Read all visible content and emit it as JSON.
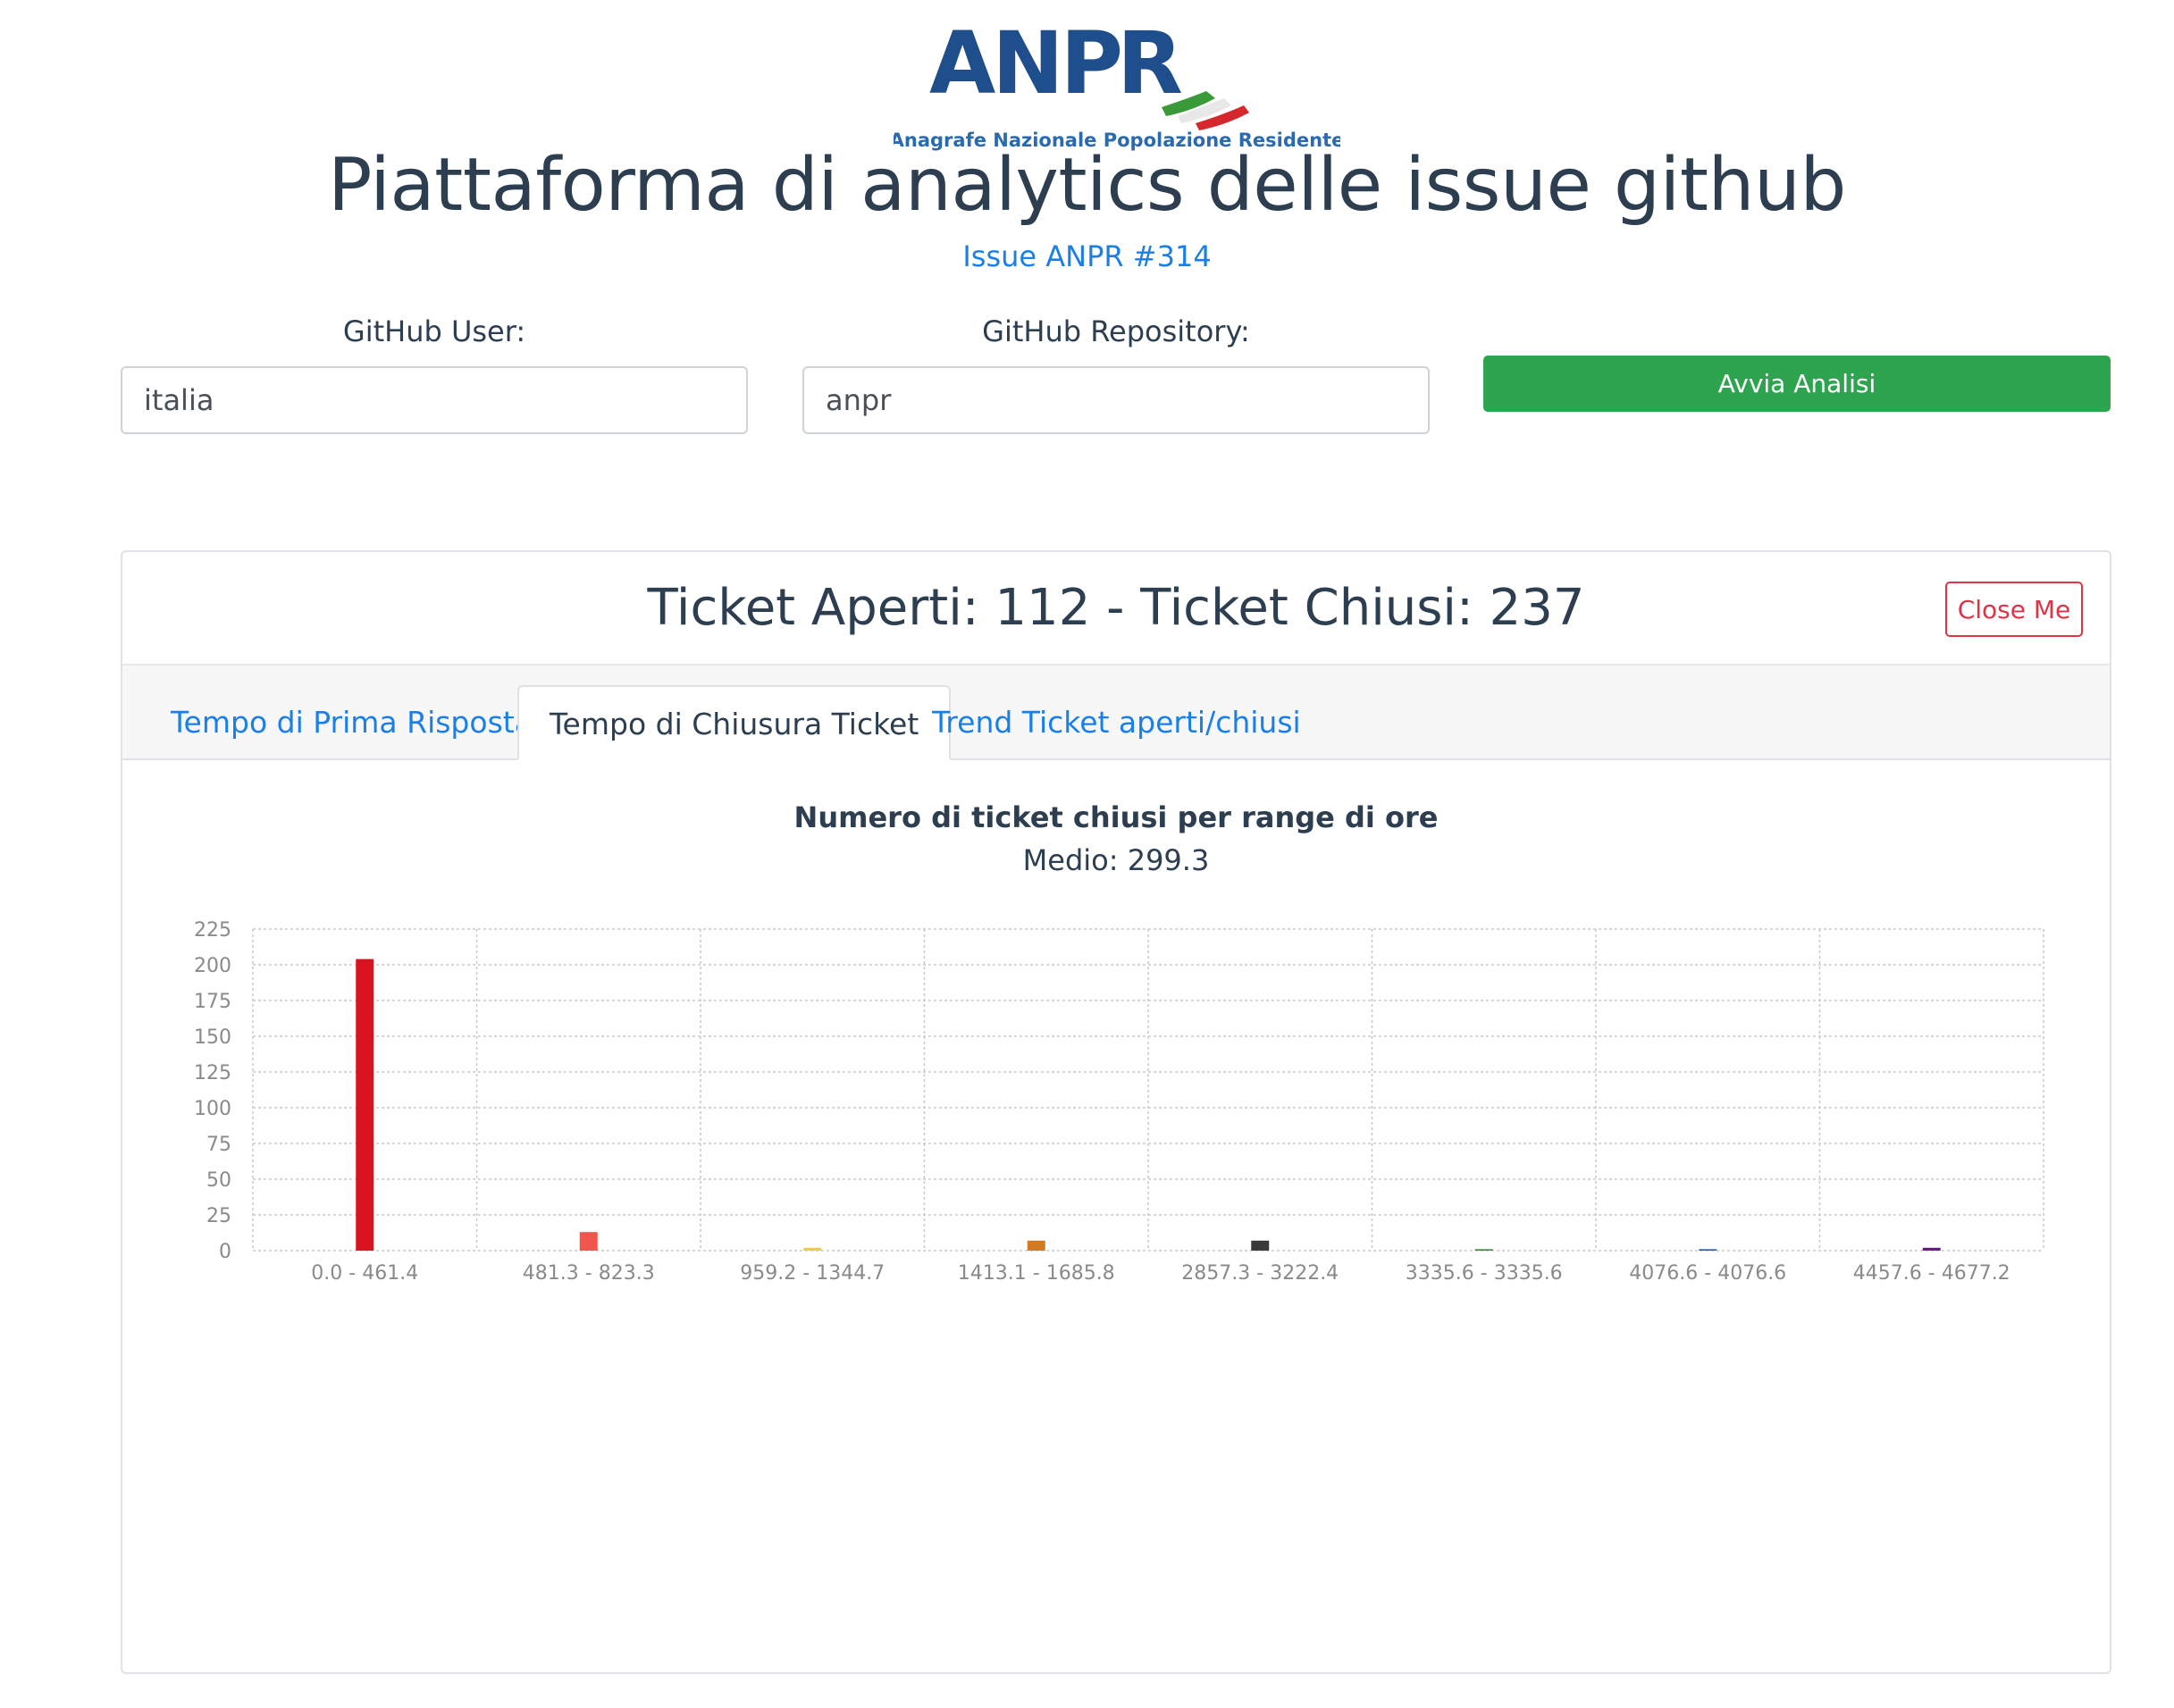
{
  "logo": {
    "brand": "ANPR",
    "tagline": "Anagrafe Nazionale Popolazione Residente",
    "colors": {
      "brand_blue": "#1f4e8c",
      "flag_green": "#3a9a3a",
      "flag_red": "#d6262e"
    }
  },
  "header": {
    "title": "Piattaforma di analytics delle issue github",
    "issue_link": "Issue ANPR #314"
  },
  "form": {
    "user_label": "GitHub User:",
    "user_value": "italia",
    "repo_label": "GitHub Repository:",
    "repo_value": "anpr",
    "start_button": "Avvia Analisi"
  },
  "results": {
    "title": "Ticket Aperti: 112 - Ticket Chiusi: 237",
    "close_button": "Close Me",
    "tabs": [
      {
        "label": "Tempo di Prima Risposta",
        "active": false
      },
      {
        "label": "Tempo di Chiusura Ticket",
        "active": true
      },
      {
        "label": "Trend Ticket aperti/chiusi",
        "active": false
      }
    ]
  },
  "chart_data": {
    "type": "bar",
    "title": "Numero di ticket chiusi per range di ore",
    "subtitle": "Medio: 299.3",
    "xlabel": "",
    "ylabel": "",
    "ylim": [
      0,
      225
    ],
    "yticks": [
      0,
      25,
      50,
      75,
      100,
      125,
      150,
      175,
      200,
      225
    ],
    "grid": true,
    "categories": [
      "0.0 - 461.4",
      "481.3 - 823.3",
      "959.2 - 1344.7",
      "1413.1 - 1685.8",
      "2857.3 - 3222.4",
      "3335.6 - 3335.6",
      "4076.6 - 4076.6",
      "4457.6 - 4677.2"
    ],
    "values": [
      204,
      13,
      2,
      7,
      7,
      1,
      1,
      2
    ],
    "colors": [
      "#d7141f",
      "#f0564e",
      "#f2c94c",
      "#d27a21",
      "#3a3a3a",
      "#2f8a2f",
      "#2255bb",
      "#6a1a80"
    ]
  }
}
